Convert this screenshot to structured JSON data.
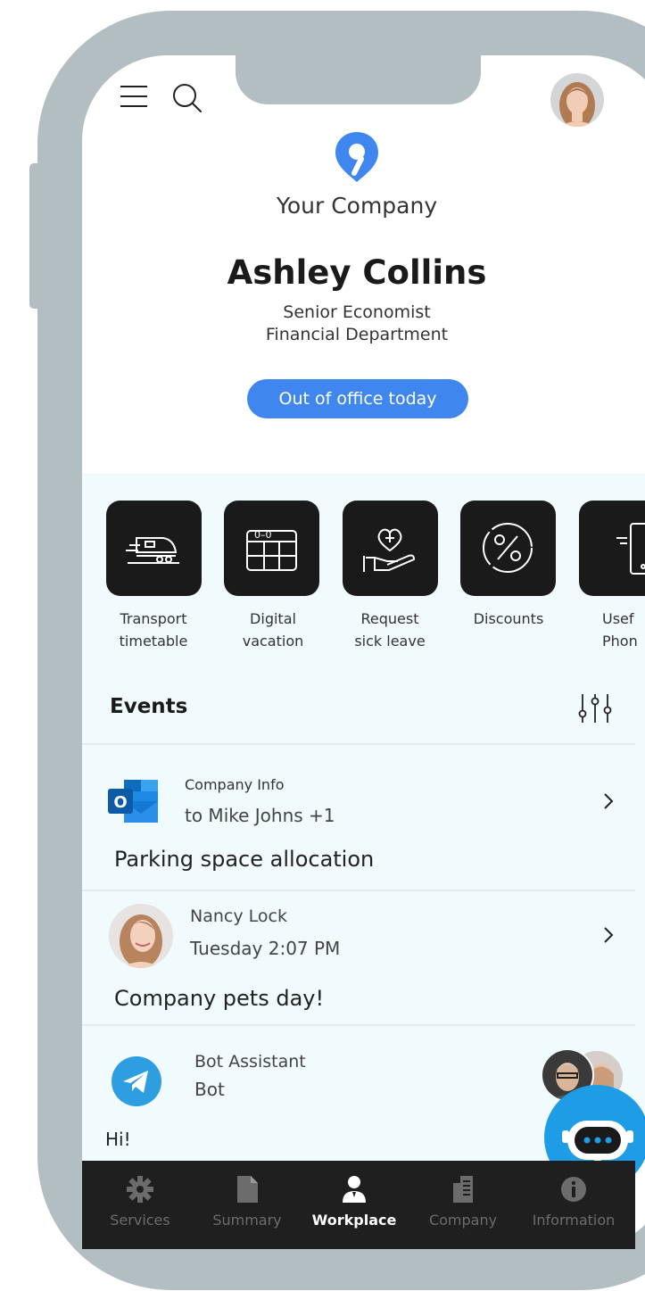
{
  "header": {
    "company_name": "Your Company"
  },
  "profile": {
    "name": "Ashley Collins",
    "title": "Senior Economist",
    "department": "Financial Department",
    "status_button": "Out of office today"
  },
  "quick_actions": [
    {
      "line1": "Transport",
      "line2": "timetable",
      "icon": "train-icon"
    },
    {
      "line1": "Digital",
      "line2": "vacation",
      "icon": "calendar-icon"
    },
    {
      "line1": "Request",
      "line2": "sick leave",
      "icon": "heart-hand-icon"
    },
    {
      "line1": "Discounts",
      "line2": "",
      "icon": "percent-icon"
    },
    {
      "line1": "Usef",
      "line2": "Phon",
      "icon": "phone-icon"
    }
  ],
  "events": {
    "title": "Events",
    "items": [
      {
        "sender": "Company Info",
        "detail": "to Mike Johns +1",
        "subject": "Parking space allocation",
        "icon": "outlook-icon"
      },
      {
        "sender": "Nancy Lock",
        "detail": "Tuesday 2:07 PM",
        "subject": "Company pets day!",
        "icon": "avatar"
      },
      {
        "sender": "Bot Assistant",
        "detail": "Bot",
        "subject": "Hi!",
        "icon": "telegram-icon"
      }
    ]
  },
  "nav": {
    "items": [
      {
        "label": "Services",
        "icon": "gear-icon"
      },
      {
        "label": "Summary",
        "icon": "document-icon"
      },
      {
        "label": "Workplace",
        "icon": "person-icon"
      },
      {
        "label": "Company",
        "icon": "building-icon"
      },
      {
        "label": "Information",
        "icon": "info-icon"
      }
    ],
    "active": "Workplace"
  },
  "colors": {
    "accent": "#3f87ee",
    "frame": "#b3bec2",
    "section_bg": "#f1fafc",
    "bot_fab": "#1e9de6",
    "nav_bg": "#1f1f1f"
  }
}
